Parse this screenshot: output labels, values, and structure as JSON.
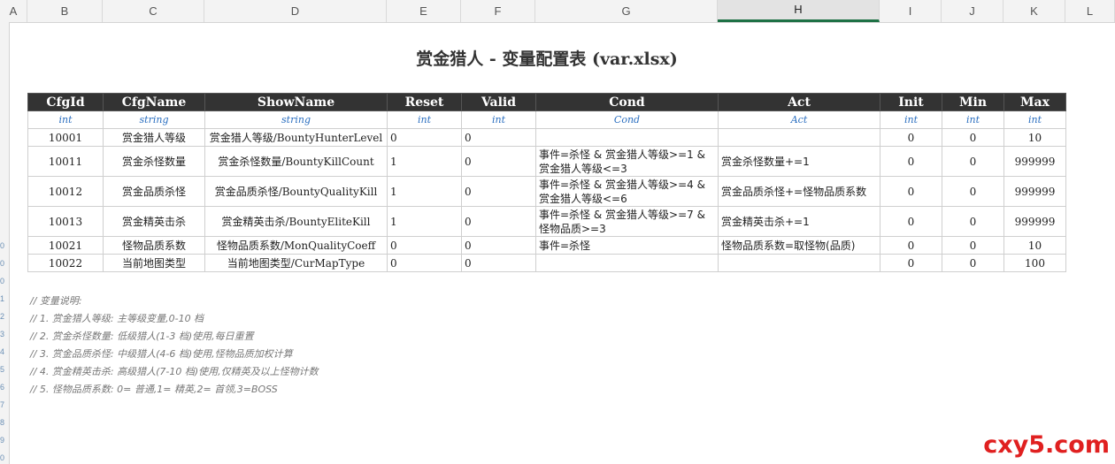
{
  "column_headers": [
    "A",
    "B",
    "C",
    "D",
    "E",
    "F",
    "G",
    "H",
    "I",
    "J",
    "K",
    "L"
  ],
  "active_column": "H",
  "row_markers": [
    "0",
    "0",
    "0",
    "1",
    "2",
    "3",
    "4",
    "5",
    "6",
    "7",
    "8",
    "9",
    "0"
  ],
  "title": "赏金猎人 - 变量配置表 (var.xlsx)",
  "table": {
    "headers": [
      "CfgId",
      "CfgName",
      "ShowName",
      "Reset",
      "Valid",
      "Cond",
      "Act",
      "Init",
      "Min",
      "Max"
    ],
    "types": [
      "int",
      "string",
      "string",
      "int",
      "int",
      "Cond",
      "Act",
      "int",
      "int",
      "int"
    ],
    "rows": [
      [
        "10001",
        "赏金猎人等级",
        "赏金猎人等级/BountyHunterLevel",
        "0",
        "0",
        "",
        "",
        "0",
        "0",
        "10"
      ],
      [
        "10011",
        "赏金杀怪数量",
        "赏金杀怪数量/BountyKillCount",
        "1",
        "0",
        "事件=杀怪 & 赏金猎人等级>=1 & 赏金猎人等级<=3",
        "赏金杀怪数量+=1",
        "0",
        "0",
        "999999"
      ],
      [
        "10012",
        "赏金品质杀怪",
        "赏金品质杀怪/BountyQualityKill",
        "1",
        "0",
        "事件=杀怪 & 赏金猎人等级>=4 & 赏金猎人等级<=6",
        "赏金品质杀怪+=怪物品质系数",
        "0",
        "0",
        "999999"
      ],
      [
        "10013",
        "赏金精英击杀",
        "赏金精英击杀/BountyEliteKill",
        "1",
        "0",
        "事件=杀怪 & 赏金猎人等级>=7 & 怪物品质>=3",
        "赏金精英击杀+=1",
        "0",
        "0",
        "999999"
      ],
      [
        "10021",
        "怪物品质系数",
        "怪物品质系数/MonQualityCoeff",
        "0",
        "0",
        "事件=杀怪",
        "怪物品质系数=取怪物(品质)",
        "0",
        "0",
        "10"
      ],
      [
        "10022",
        "当前地图类型",
        "当前地图类型/CurMapType",
        "0",
        "0",
        "",
        "",
        "0",
        "0",
        "100"
      ]
    ]
  },
  "comments": [
    "// 变量说明:",
    "// 1. 赏金猎人等级: 主等级变量,0-10 档",
    "// 2. 赏金杀怪数量: 低级猎人(1-3 档)使用,每日重置",
    "// 3. 赏金品质杀怪: 中级猎人(4-6 档)使用,怪物品质加权计算",
    "// 4. 赏金精英击杀: 高级猎人(7-10 档)使用,仅精英及以上怪物计数",
    "// 5. 怪物品质系数: 0= 普通,1= 精英,2= 首领,3=BOSS"
  ],
  "watermark": "cxy5.com"
}
